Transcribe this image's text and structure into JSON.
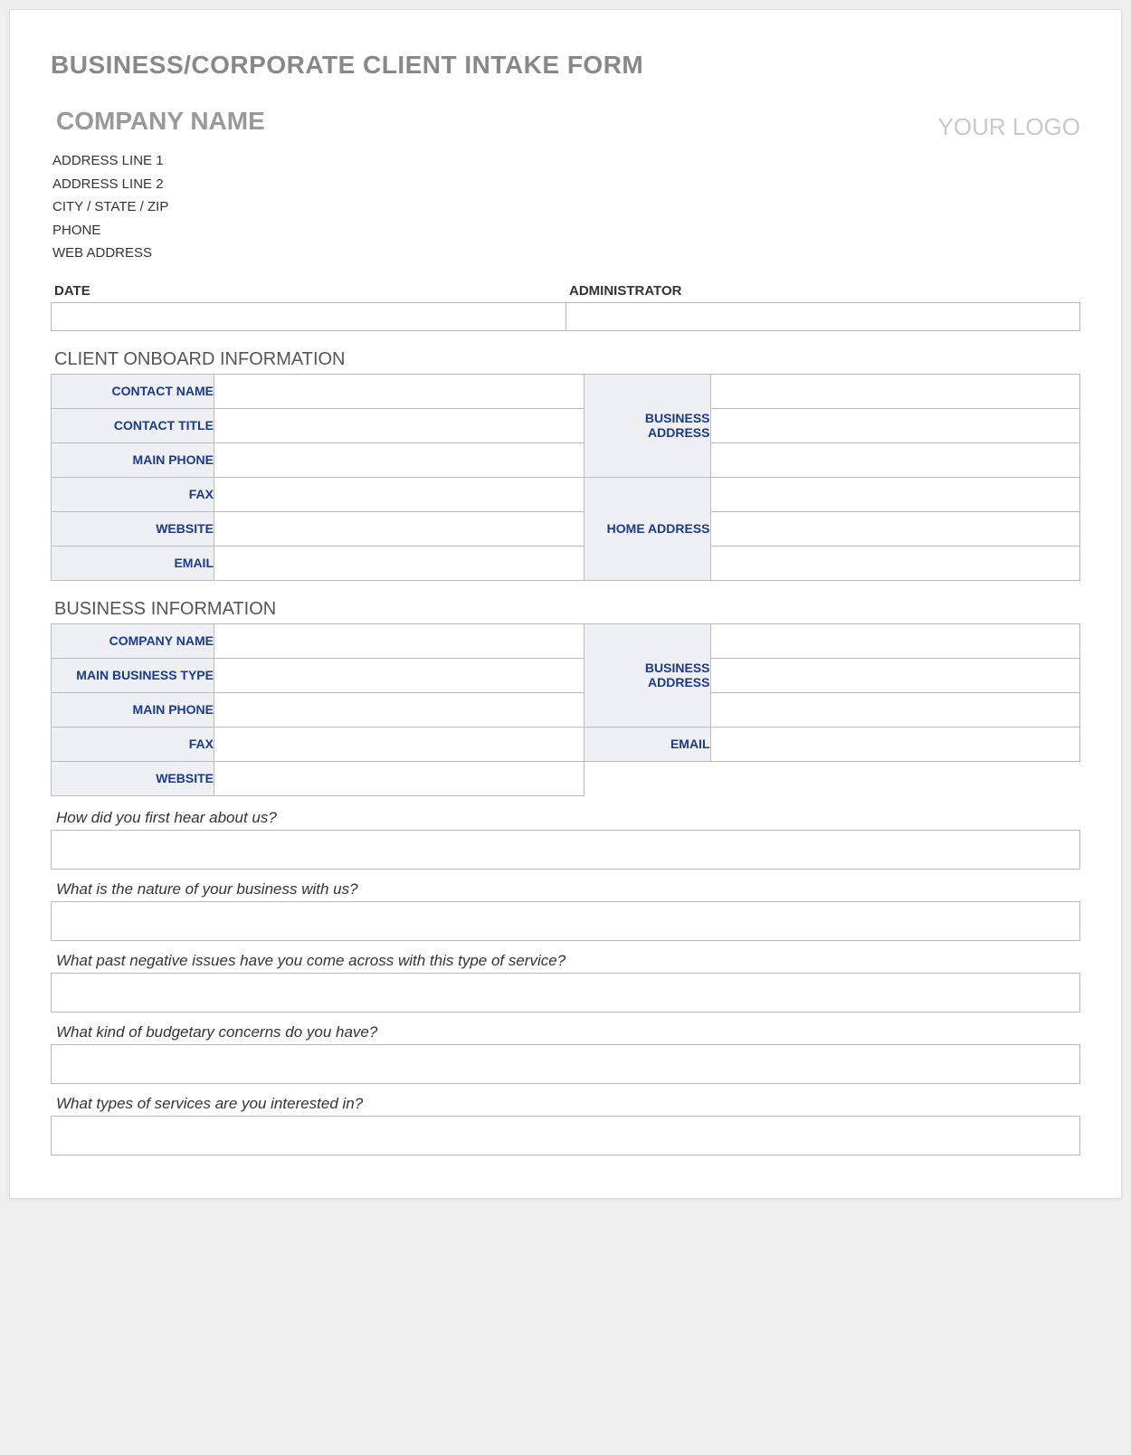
{
  "form_title": "BUSINESS/CORPORATE CLIENT INTAKE FORM",
  "company": {
    "name": "COMPANY NAME",
    "address1": "ADDRESS LINE 1",
    "address2": "ADDRESS LINE 2",
    "city_state_zip": "CITY / STATE / ZIP",
    "phone": "PHONE",
    "web": "WEB ADDRESS"
  },
  "logo_placeholder": "YOUR LOGO",
  "date_admin": {
    "date_label": "DATE",
    "admin_label": "ADMINISTRATOR"
  },
  "sections": {
    "client_onboard_title": "CLIENT ONBOARD INFORMATION",
    "business_info_title": "BUSINESS INFORMATION"
  },
  "client_onboard": {
    "contact_name": "CONTACT NAME",
    "contact_title": "CONTACT TITLE",
    "main_phone": "MAIN PHONE",
    "fax": "FAX",
    "website": "WEBSITE",
    "email": "EMAIL",
    "business_address": "BUSINESS ADDRESS",
    "home_address": "HOME ADDRESS"
  },
  "business_info": {
    "company_name": "COMPANY NAME",
    "main_business_type": "MAIN BUSINESS TYPE",
    "main_phone": "MAIN PHONE",
    "fax": "FAX",
    "website": "WEBSITE",
    "business_address": "BUSINESS ADDRESS",
    "email": "EMAIL"
  },
  "questions": {
    "q1": "How did you first hear about us?",
    "q2": "What is the nature of your business with us?",
    "q3": "What past negative issues have you come across with this type of service?",
    "q4": "What kind of budgetary concerns do you have?",
    "q5": "What types of services are you interested in?"
  }
}
